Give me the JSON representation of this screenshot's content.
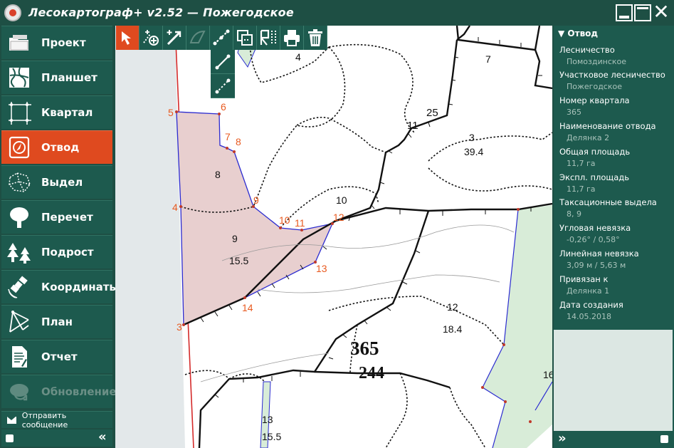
{
  "window": {
    "title": "Лесокартограф+ v2.52 — Пожегодское"
  },
  "sidebar": {
    "items": [
      {
        "label": "Проект",
        "icon": "folder-icon"
      },
      {
        "label": "Планшет",
        "icon": "map-sheet-icon"
      },
      {
        "label": "Квартал",
        "icon": "quarter-polygon-icon"
      },
      {
        "label": "Отвод",
        "icon": "compass-allotment-icon"
      },
      {
        "label": "Выдел",
        "icon": "parcel-dots-icon"
      },
      {
        "label": "Перечет",
        "icon": "tree-icon"
      },
      {
        "label": "Подрост",
        "icon": "undergrowth-icon"
      },
      {
        "label": "Координаты",
        "icon": "satellite-icon"
      },
      {
        "label": "План",
        "icon": "compass-plan-icon"
      },
      {
        "label": "Отчет",
        "icon": "report-icon"
      },
      {
        "label": "Обновление",
        "icon": "update-icon"
      }
    ],
    "active_item": "Отвод",
    "send_message": "Отправить сообщение",
    "collapse_chevron": "«"
  },
  "toolbar": {
    "tools": [
      "select-arrow-icon",
      "add-point-icon",
      "add-segment-icon",
      "draw-arc-icon",
      "measure-segment-icon",
      "copy-layer-icon",
      "edit-table-icon",
      "print-icon",
      "delete-icon"
    ],
    "subtools": [
      "segment-icon",
      "dashed-segment-icon"
    ]
  },
  "map": {
    "point_labels": [
      {
        "n": "3"
      },
      {
        "n": "4"
      },
      {
        "n": "5"
      },
      {
        "n": "6"
      },
      {
        "n": "7"
      },
      {
        "n": "8"
      },
      {
        "n": "9"
      },
      {
        "n": "10"
      },
      {
        "n": "11"
      },
      {
        "n": "12"
      },
      {
        "n": "13"
      },
      {
        "n": "14"
      }
    ],
    "parcel_labels": [
      {
        "t": "4"
      },
      {
        "t": "7"
      },
      {
        "t": "11"
      },
      {
        "t": "25"
      },
      {
        "t": "3"
      },
      {
        "t": "39.4"
      },
      {
        "t": "8"
      },
      {
        "t": "10"
      },
      {
        "t": "9"
      },
      {
        "t": "15.5"
      },
      {
        "t": "12"
      },
      {
        "t": "18.4"
      },
      {
        "t": "13"
      },
      {
        "t": "15.5"
      },
      {
        "t": "16"
      }
    ],
    "quarter_number": "365",
    "quarter_area": "244",
    "colors": {
      "allotment_fill": "#e8cfcf",
      "allotment_border": "#2b2bd0",
      "green_fill": "#d8ecd8",
      "point_label": "#e85a20",
      "boundary": "#111111"
    }
  },
  "properties": {
    "header": "▼ Отвод",
    "fields": [
      {
        "label": "Лесничество",
        "value": "Помоздинское"
      },
      {
        "label": "Участковое лесничество",
        "value": "Пожегодское"
      },
      {
        "label": "Номер квартала",
        "value": "365"
      },
      {
        "label": "Наименование отвода",
        "value": "Делянка 2"
      },
      {
        "label": "Общая площадь",
        "value": "11,7 га"
      },
      {
        "label": "Экспл. площадь",
        "value": "11,7 га"
      },
      {
        "label": "Таксационные выдела",
        "value": "8, 9"
      },
      {
        "label": "Угловая невязка",
        "value": "-0,26° / 0,58°"
      },
      {
        "label": "Линейная невязка",
        "value": "3,09 м / 5,63 м"
      },
      {
        "label": "Привязан к",
        "value": "Делянка 1"
      },
      {
        "label": "Дата создания",
        "value": "14.05.2018"
      }
    ],
    "expand_chevron": "»"
  }
}
